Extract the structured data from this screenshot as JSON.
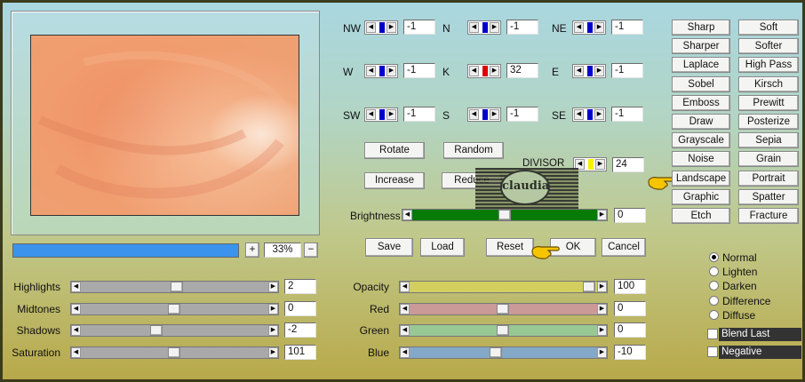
{
  "directions": [
    {
      "label": "NW",
      "value": "-1",
      "marker": "#0000cc"
    },
    {
      "label": "N",
      "value": "-1",
      "marker": "#0000cc"
    },
    {
      "label": "NE",
      "value": "-1",
      "marker": "#0000cc"
    },
    {
      "label": "W",
      "value": "-1",
      "marker": "#0000cc"
    },
    {
      "label": "K",
      "value": "32",
      "marker": "#dd0000"
    },
    {
      "label": "E",
      "value": "-1",
      "marker": "#0000cc"
    },
    {
      "label": "SW",
      "value": "-1",
      "marker": "#0000cc"
    },
    {
      "label": "S",
      "value": "-1",
      "marker": "#0000cc"
    },
    {
      "label": "SE",
      "value": "-1",
      "marker": "#0000cc"
    }
  ],
  "divisor": {
    "label": "DIVISOR",
    "value": "24"
  },
  "mid_buttons": {
    "rotate": "Rotate",
    "random": "Random",
    "increase": "Increase",
    "reduce": "Reduce"
  },
  "brightness": {
    "label": "Brightness",
    "value": "0",
    "level": 0.5
  },
  "file_buttons": {
    "save": "Save",
    "load": "Load",
    "reset": "Reset",
    "ok": "OK",
    "cancel": "Cancel"
  },
  "zoom": {
    "plus": "+",
    "value": "33%",
    "minus": "−",
    "progress": 1.0
  },
  "presets": [
    [
      "Sharp",
      "Soft"
    ],
    [
      "Sharper",
      "Softer"
    ],
    [
      "Laplace",
      "High Pass"
    ],
    [
      "Sobel",
      "Kirsch"
    ],
    [
      "Emboss",
      "Prewitt"
    ],
    [
      "Draw",
      "Posterize"
    ],
    [
      "Grayscale",
      "Sepia"
    ],
    [
      "Noise",
      "Grain"
    ],
    [
      "Landscape",
      "Portrait"
    ],
    [
      "Graphic",
      "Spatter"
    ],
    [
      "Etch",
      "Fracture"
    ]
  ],
  "adjust_left": [
    {
      "label": "Highlights",
      "value": "2",
      "level": 0.52
    },
    {
      "label": "Midtones",
      "value": "0",
      "level": 0.5
    },
    {
      "label": "Shadows",
      "value": "-2",
      "level": 0.4
    },
    {
      "label": "Saturation",
      "value": "101",
      "level": 0.5
    }
  ],
  "adjust_right": [
    {
      "label": "Opacity",
      "value": "100",
      "level": 1.0,
      "color": "#d2cf5e"
    },
    {
      "label": "Red",
      "value": "0",
      "level": 0.5,
      "color": "#c99a97"
    },
    {
      "label": "Green",
      "value": "0",
      "level": 0.5,
      "color": "#98c893"
    },
    {
      "label": "Blue",
      "value": "-10",
      "level": 0.46,
      "color": "#84a8c8"
    }
  ],
  "blend_modes": {
    "options": [
      "Normal",
      "Lighten",
      "Darken",
      "Difference",
      "Diffuse"
    ],
    "selected": "Normal"
  },
  "checkboxes": {
    "blend_last": "Blend Last",
    "negative": "Negative"
  },
  "watermark": {
    "text": "claudia"
  }
}
